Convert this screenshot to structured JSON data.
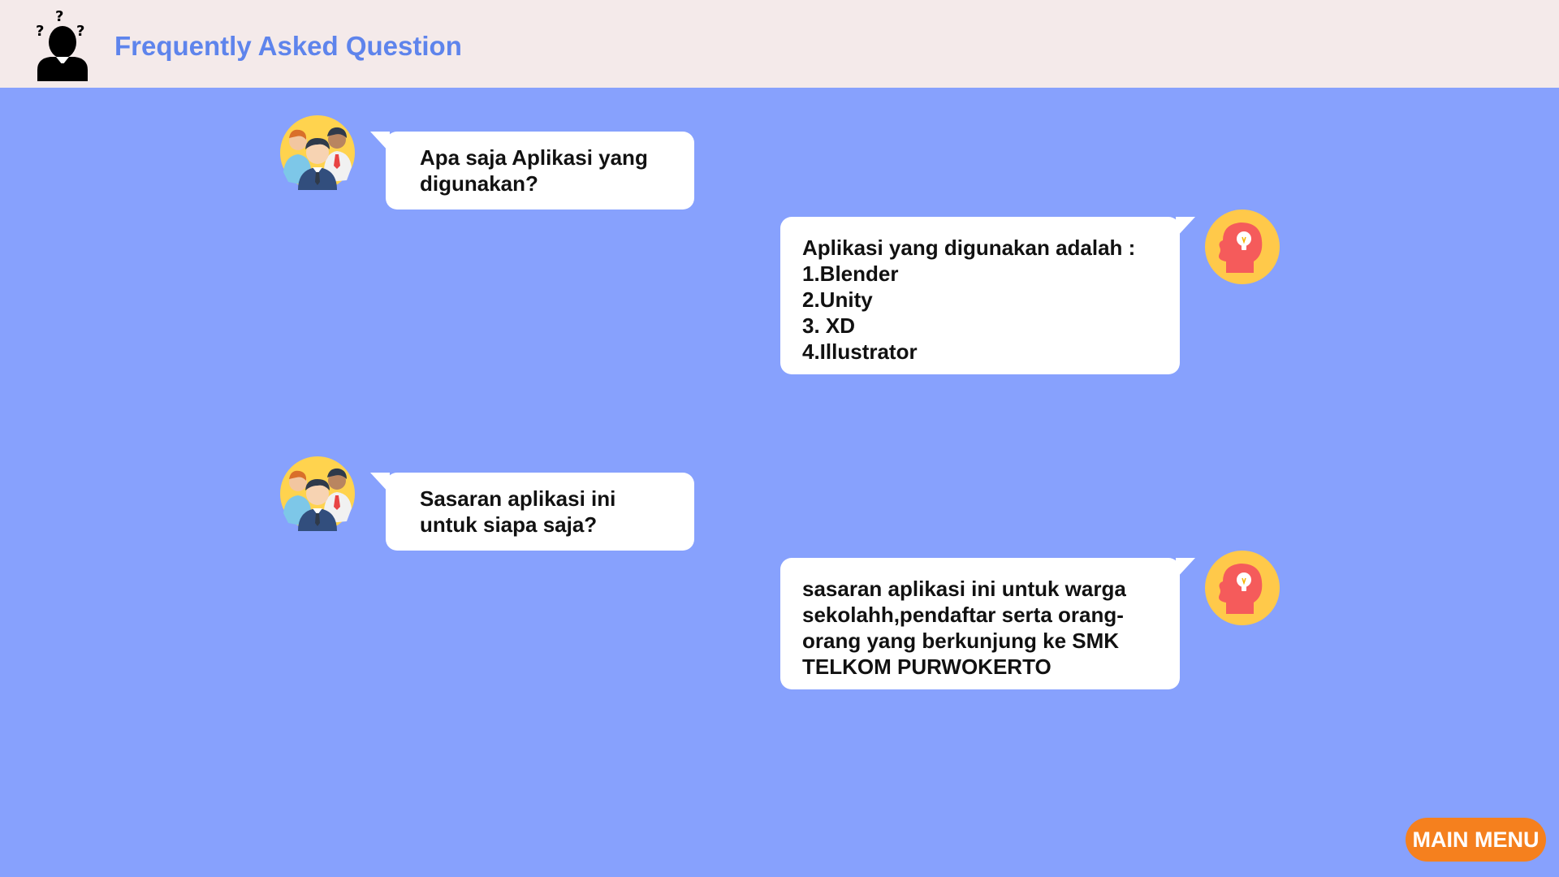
{
  "header": {
    "title": "Frequently Asked Question",
    "icon": "confused-person-icon"
  },
  "conversation": [
    {
      "role": "question",
      "avatar": "group-of-people-avatar",
      "text": "Apa saja Aplikasi yang digunakan?"
    },
    {
      "role": "answer",
      "avatar": "head-lightbulb-avatar",
      "lines": [
        "Aplikasi yang digunakan adalah :",
        "1.Blender",
        "2.Unity",
        "3. XD",
        "4.Illustrator"
      ]
    },
    {
      "role": "question",
      "avatar": "group-of-people-avatar",
      "text": "Sasaran aplikasi ini untuk siapa saja?"
    },
    {
      "role": "answer",
      "avatar": "head-lightbulb-avatar",
      "text": "sasaran aplikasi ini untuk warga sekolahh,pendaftar serta orang-orang yang berkunjung ke SMK TELKOM PURWOKERTO"
    }
  ],
  "footer": {
    "main_menu_label": "MAIN MENU"
  },
  "colors": {
    "background": "#87a1fd",
    "header_bg": "#f4eaea",
    "title": "#5e84ec",
    "bubble": "#ffffff",
    "button": "#f5801e",
    "avatar_bg": "#ffc94a",
    "head_red": "#f55b5b"
  }
}
